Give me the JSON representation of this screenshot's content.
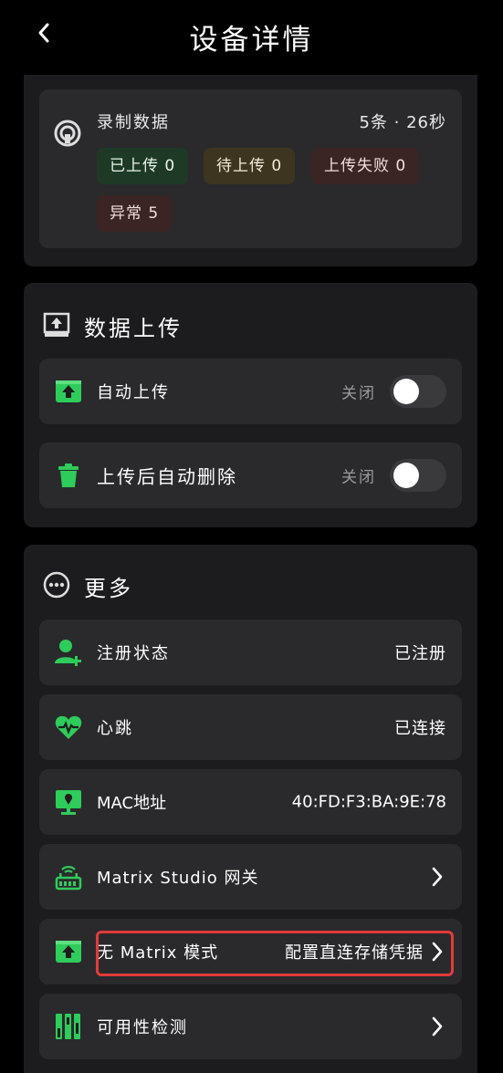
{
  "header": {
    "title": "设备详情"
  },
  "recording": {
    "label": "录制数据",
    "summary": "5条 · 26秒",
    "tags": {
      "uploaded": "已上传 0",
      "pending": "待上传 0",
      "failed": "上传失败 0",
      "abnormal": "异常 5"
    }
  },
  "upload": {
    "title": "数据上传",
    "auto_upload": {
      "label": "自动上传",
      "state": "关闭"
    },
    "auto_delete": {
      "label": "上传后自动删除",
      "state": "关闭"
    }
  },
  "more": {
    "title": "更多",
    "register": {
      "label": "注册状态",
      "value": "已注册"
    },
    "heartbeat": {
      "label": "心跳",
      "value": "已连接"
    },
    "mac": {
      "label": "MAC地址",
      "value": "40:FD:F3:BA:9E:78"
    },
    "gateway": {
      "label": "Matrix Studio 网关"
    },
    "no_matrix": {
      "label": "无 Matrix 模式",
      "value": "配置直连存储凭据"
    },
    "availability": {
      "label": "可用性检测"
    }
  },
  "colors": {
    "accent_green": "#2ecc5a",
    "card_bg": "#1c1c1e",
    "row_bg": "#2a2a2c",
    "highlight": "#e23b3b"
  }
}
